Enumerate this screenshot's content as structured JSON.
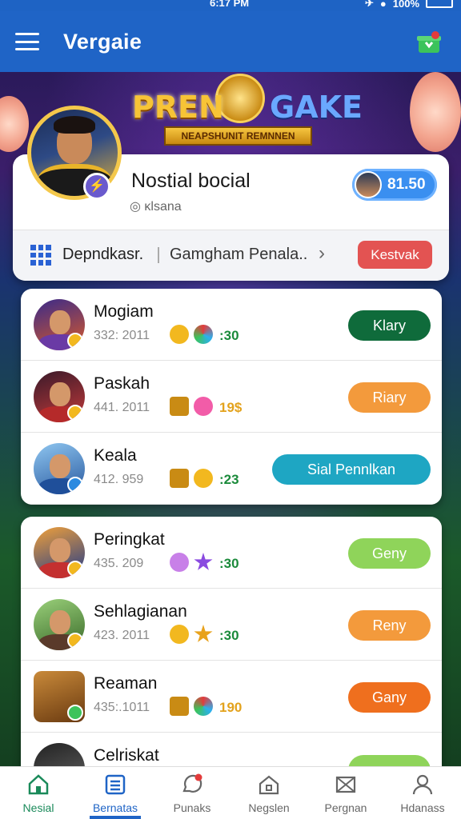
{
  "status_bar": {
    "time": "6:17 PM",
    "battery": "100%"
  },
  "header": {
    "title": "Vergaie"
  },
  "banner": {
    "logo_left": "PREN",
    "logo_right": "GAKE",
    "logo_subtitle": "NEAPSHUNIT REMNNEN"
  },
  "profile": {
    "name": "Nostial bocial",
    "handle": "◎ ĸlsana",
    "coins": "81.50",
    "band_left": "Depndkasr.",
    "band_right": "Gamgham Penala..",
    "band_button": "Kestvak"
  },
  "list_top": [
    {
      "name": "Mogiam",
      "score": "332: 2011",
      "points": ":30",
      "button": "Klary"
    },
    {
      "name": "Paskah",
      "score": "441. 2011",
      "points": "19$",
      "button": "Riary"
    },
    {
      "name": "Keala",
      "score": "412. 959",
      "points": ":23",
      "button": "Sial Pennlkan"
    }
  ],
  "list_bottom": [
    {
      "name": "Peringkat",
      "score": "435. 209",
      "points": ":30",
      "button": "Geny"
    },
    {
      "name": "Sehlagianan",
      "score": "423. 2011",
      "points": ":30",
      "button": "Reny"
    },
    {
      "name": "Reaman",
      "score": "435:.1011",
      "points": "190",
      "button": "Gany"
    },
    {
      "name": "Celriskat",
      "score": "",
      "points": "",
      "button": ""
    }
  ],
  "tabs": [
    {
      "label": "Nesial",
      "icon": "home-icon"
    },
    {
      "label": "Bernatas",
      "icon": "list-icon"
    },
    {
      "label": "Punaks",
      "icon": "chat-icon"
    },
    {
      "label": "Negslen",
      "icon": "house-icon"
    },
    {
      "label": "Pergnan",
      "icon": "mail-icon"
    },
    {
      "label": "Hdanass",
      "icon": "person-icon"
    }
  ],
  "colors": {
    "header_blue": "#1f64c6",
    "button_dark_green": "#0f6b3b",
    "button_orange": "#f39a3c",
    "button_teal": "#1ea6c3",
    "button_light_green": "#8fd45a",
    "button_dark_orange": "#ef6f1e",
    "button_red": "#e35352"
  }
}
